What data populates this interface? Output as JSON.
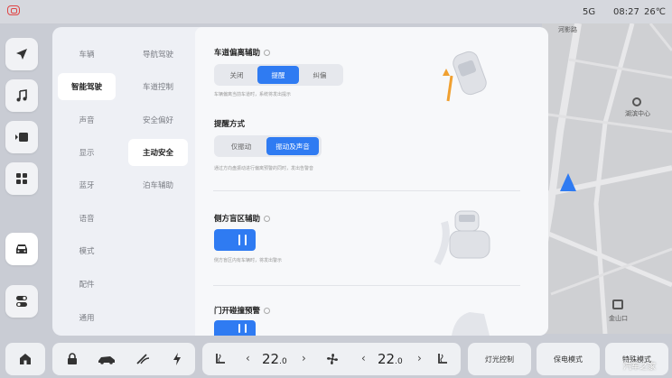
{
  "status": {
    "signal": "5G",
    "time": "08:27",
    "temperature": "26℃"
  },
  "map": {
    "labels": [
      "河影路",
      "湖滨中心",
      "金山口"
    ]
  },
  "nav_rail": {
    "items": [
      "navigation-icon",
      "music-icon",
      "video-icon",
      "apps-icon",
      "car-icon",
      "toggle-settings-icon"
    ],
    "active": "car-icon"
  },
  "settings": {
    "level1": [
      "车辆",
      "智能驾驶",
      "声音",
      "显示",
      "蓝牙",
      "语音",
      "模式",
      "配件",
      "通用"
    ],
    "level1_active": "智能驾驶",
    "level2": [
      "导航驾驶",
      "车道控制",
      "安全偏好",
      "主动安全",
      "泊车辅助"
    ],
    "level2_active": "主动安全",
    "lane_departure": {
      "title": "车道偏离辅助",
      "options": [
        "关闭",
        "提醒",
        "纠偏"
      ],
      "selected": "提醒",
      "desc": "车辆偏离当前车道时，系统将发出提示"
    },
    "alert_mode": {
      "title": "提醒方式",
      "options": [
        "仅振动",
        "振动及声音"
      ],
      "selected": "振动及声音",
      "desc": "通过方向盘振动进行偏离预警的同时，发出告警音"
    },
    "blind_spot": {
      "title": "侧方盲区辅助",
      "enabled": true,
      "desc": "侧方盲区内有车辆时，将发出警示"
    },
    "door_open_warning": {
      "title": "门开碰撞预警",
      "enabled": true
    }
  },
  "bottom": {
    "left_temp": "22",
    "left_temp_decimal": ".0",
    "right_temp": "22",
    "right_temp_decimal": ".0",
    "arrow_left": "‹",
    "arrow_right": "›",
    "buttons": [
      "灯光控制",
      "保电模式",
      "特殊模式"
    ]
  },
  "watermark": "汽车之家",
  "colors": {
    "accent": "#2f7bf2",
    "warning": "#f0a030"
  }
}
